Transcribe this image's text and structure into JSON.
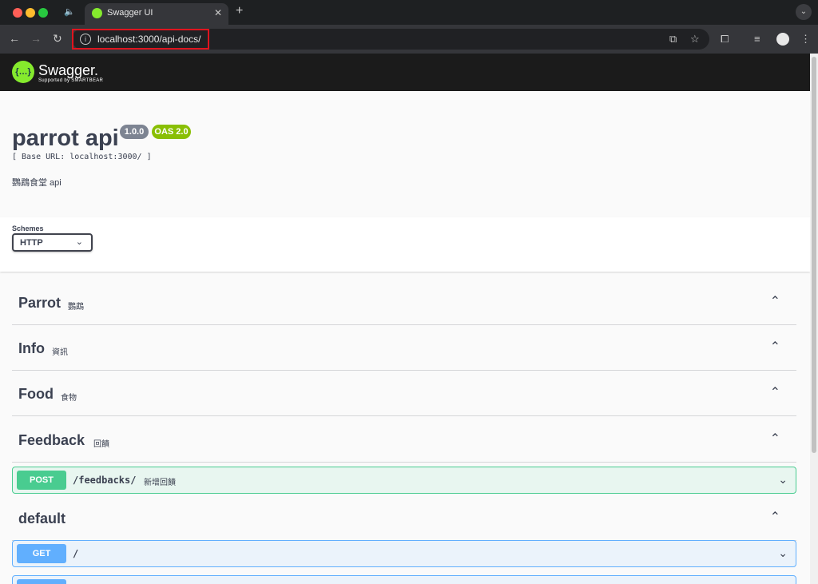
{
  "browser": {
    "tab_title": "Swagger UI",
    "url": "localhost:3000/api-docs/",
    "highlight_color": "#e0141e"
  },
  "swagger_header": {
    "logo_glyph": "{…}",
    "name": "Swagger.",
    "tagline": "Supported by SMARTBEAR",
    "brand_color": "#85ea2d"
  },
  "info": {
    "title": "parrot api",
    "version": "1.0.0",
    "oas": "OAS 2.0",
    "base_url": "[ Base URL: localhost:3000/ ]",
    "description": "鸚鵡食堂 api"
  },
  "schemes": {
    "label": "Schemes",
    "selected": "HTTP"
  },
  "tags": [
    {
      "name": "Parrot",
      "description": "鸚鵡"
    },
    {
      "name": "Info",
      "description": "資訊"
    },
    {
      "name": "Food",
      "description": "食物"
    },
    {
      "name": "Feedback",
      "description": "回饋"
    },
    {
      "name": "default",
      "description": ""
    }
  ],
  "operations": [
    {
      "method": "POST",
      "path": "/feedbacks/",
      "summary": "新增回饋",
      "color": "#49cc90"
    },
    {
      "method": "GET",
      "path": "/",
      "summary": "",
      "color": "#61affe"
    }
  ]
}
